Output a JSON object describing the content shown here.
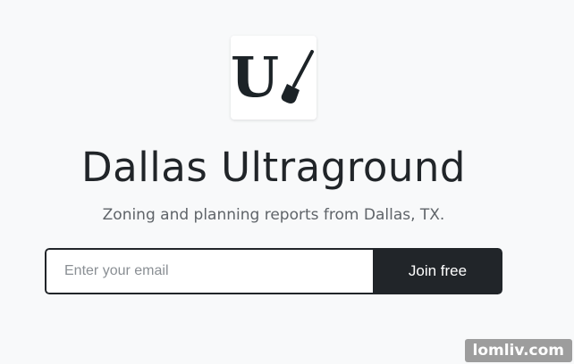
{
  "logo": {
    "letter": "U",
    "icon": "shovel-icon"
  },
  "header": {
    "title": "Dallas Ultraground",
    "subtitle": "Zoning and planning reports from Dallas, TX."
  },
  "signup": {
    "email_placeholder": "Enter your email",
    "email_value": "",
    "button_label": "Join free"
  },
  "watermark": {
    "text": "lomliv.com"
  },
  "colors": {
    "background": "#f8f9fa",
    "primary_dark": "#212529",
    "subtitle_text": "#5f6469"
  }
}
